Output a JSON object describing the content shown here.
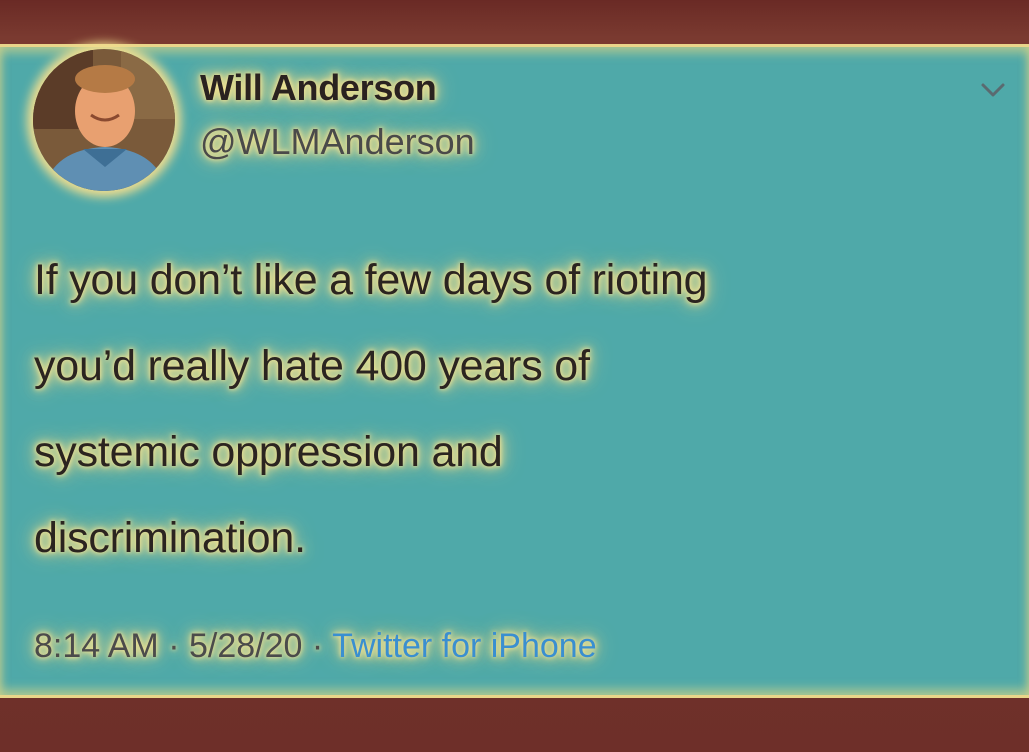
{
  "tweet": {
    "author_name": "Will Anderson",
    "author_handle": "@WLMAnderson",
    "text_lines": [
      "If you don’t like a few days of rioting",
      "you’d really hate 400 years of",
      "systemic oppression and",
      "discrimination."
    ],
    "time": "8:14 AM",
    "separator": "·",
    "date": "5/28/20",
    "source": "Twitter for iPhone"
  },
  "icons": {
    "avatar": "avatar-photo",
    "menu": "chevron-down-icon"
  },
  "colors": {
    "card_background": "#4fa9a9",
    "frame": "#6e2f29",
    "glow": "#f5e493",
    "link": "#3a8fd0"
  }
}
